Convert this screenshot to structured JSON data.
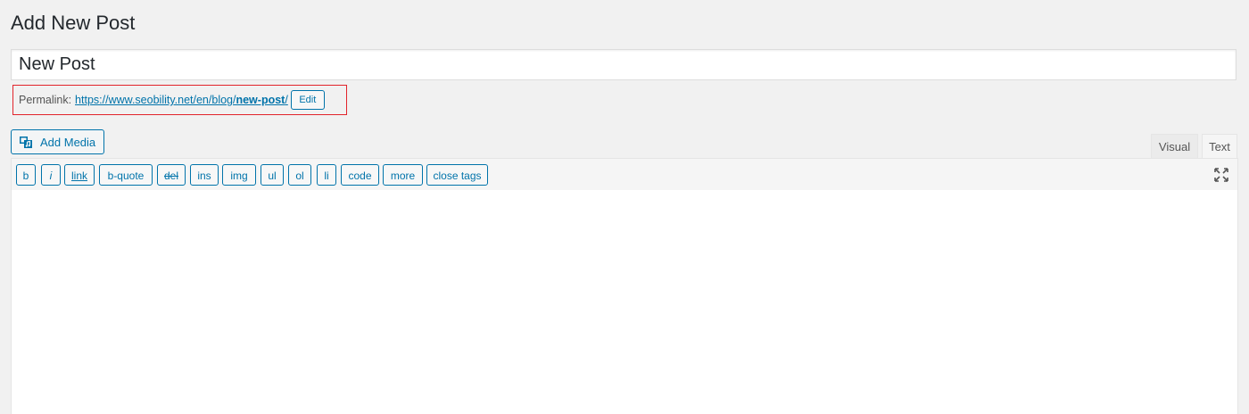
{
  "page": {
    "title": "Add New Post"
  },
  "post": {
    "title_value": "New Post"
  },
  "permalink": {
    "label": "Permalink:",
    "base_url": "https://www.seobility.net/en/blog/",
    "slug": "new-post",
    "trailing": "/",
    "edit_label": "Edit"
  },
  "media": {
    "add_label": "Add Media",
    "icon": "add-media-icon"
  },
  "tabs": {
    "visual": "Visual",
    "text": "Text",
    "active": "Text"
  },
  "quicktags": [
    {
      "label": "b"
    },
    {
      "label": "i"
    },
    {
      "label": "link"
    },
    {
      "label": "b-quote"
    },
    {
      "label": "del"
    },
    {
      "label": "ins"
    },
    {
      "label": "img"
    },
    {
      "label": "ul"
    },
    {
      "label": "ol"
    },
    {
      "label": "li"
    },
    {
      "label": "code"
    },
    {
      "label": "more"
    },
    {
      "label": "close tags"
    }
  ],
  "editor": {
    "content": "",
    "fullscreen_icon": "fullscreen-icon"
  },
  "colors": {
    "accent": "#0073aa",
    "highlight_border": "#e2242b",
    "background": "#f1f1f1"
  }
}
